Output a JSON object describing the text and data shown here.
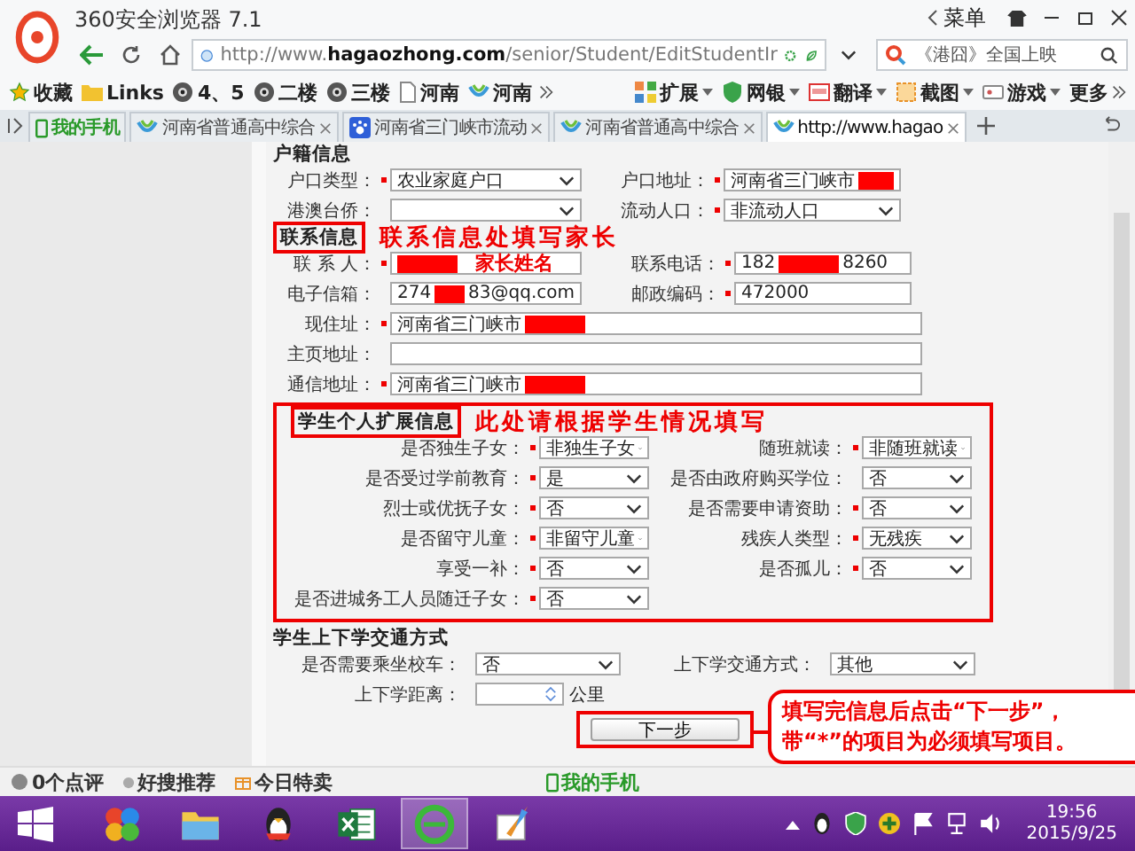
{
  "window": {
    "title": "360安全浏览器 7.1",
    "menu": "菜单"
  },
  "address_bar": {
    "url": "http://www.**hagaozhong.com**/senior/Student/EditStudentIr"
  },
  "search": {
    "value": "《港囧》全国上映"
  },
  "bookmarks": [
    {
      "label": "收藏",
      "kind": "star"
    },
    {
      "label": "Links",
      "kind": "folder"
    },
    {
      "label": "4、5",
      "kind": "camera"
    },
    {
      "label": "二楼",
      "kind": "camera"
    },
    {
      "label": "三楼",
      "kind": "camera"
    },
    {
      "label": "河南",
      "kind": "page"
    },
    {
      "label": "河南",
      "kind": "site"
    }
  ],
  "toolbar": [
    {
      "label": "扩展",
      "kind": "extensions"
    },
    {
      "label": "网银",
      "kind": "shield"
    },
    {
      "label": "翻译",
      "kind": "translate"
    },
    {
      "label": "截图",
      "kind": "screenshot"
    },
    {
      "label": "游戏",
      "kind": "game"
    },
    {
      "label": "更多",
      "kind": "more"
    }
  ],
  "tabs": [
    {
      "label": "我的手机",
      "kind": "phone",
      "selected": false
    },
    {
      "label": "河南省普通高中综合",
      "kind": "site",
      "selected": false
    },
    {
      "label": "河南省三门峡市流动",
      "kind": "paw",
      "selected": false
    },
    {
      "label": "河南省普通高中综合",
      "kind": "site",
      "selected": false
    },
    {
      "label": "http://www.hagao",
      "kind": "site",
      "selected": true
    }
  ],
  "household": {
    "title": "户籍信息",
    "fields": [
      {
        "label": "户口类型：",
        "required": true,
        "kind": "select",
        "value": "农业家庭户口"
      },
      {
        "label": "户口地址：",
        "required": true,
        "kind": "text",
        "value": "河南省三门峡市",
        "redacted": true
      },
      {
        "label": "港澳台侨：",
        "required": false,
        "kind": "select"
      },
      {
        "label": "流动人口：",
        "required": true,
        "kind": "select",
        "value": "非流动人口"
      }
    ]
  },
  "contact": {
    "title": "联系信息",
    "highlighted": true,
    "note": "联系信息处填写家长",
    "fields": [
      {
        "label": "联 系 人：",
        "required": true,
        "kind": "text",
        "redacted": true,
        "note": "家长姓名"
      },
      {
        "label": "联系电话：",
        "required": true,
        "kind": "text",
        "value": "182",
        "redacted": true,
        "value_tail": "8260"
      },
      {
        "label": "电子信箱：",
        "required": false,
        "kind": "text",
        "value": "274",
        "redacted": true,
        "value_tail": "83@qq.com"
      },
      {
        "label": "邮政编码：",
        "required": true,
        "kind": "text",
        "value": "472000"
      },
      {
        "label": "现住址：",
        "required": true,
        "kind": "wide_text",
        "value": "河南省三门峡市",
        "redacted": true
      },
      {
        "label": "主页地址：",
        "required": false,
        "kind": "wide_text"
      },
      {
        "label": "通信地址：",
        "required": true,
        "kind": "wide_text",
        "value": "河南省三门峡市",
        "redacted": true
      }
    ]
  },
  "extended": {
    "title": "学生个人扩展信息",
    "highlighted": true,
    "note": "此处请根据学生情况填写",
    "fields": [
      {
        "label": "是否独生子女：",
        "required": true,
        "kind": "select",
        "value": "非独生子女"
      },
      {
        "label": "随班就读：",
        "required": true,
        "kind": "select",
        "value": "非随班就读"
      },
      {
        "label": "是否受过学前教育：",
        "required": true,
        "kind": "select",
        "value": "是"
      },
      {
        "label": "是否由政府购买学位：",
        "required": false,
        "kind": "select",
        "value": "否"
      },
      {
        "label": "烈士或优抚子女：",
        "required": true,
        "kind": "select",
        "value": "否"
      },
      {
        "label": "是否需要申请资助：",
        "required": true,
        "kind": "select",
        "value": "否"
      },
      {
        "label": "是否留守儿童：",
        "required": true,
        "kind": "select",
        "value": "非留守儿童"
      },
      {
        "label": "残疾人类型：",
        "required": true,
        "kind": "select",
        "value": "无残疾"
      },
      {
        "label": "享受一补：",
        "required": true,
        "kind": "select",
        "value": "否"
      },
      {
        "label": "是否孤儿：",
        "required": true,
        "kind": "select",
        "value": "否"
      },
      {
        "label": "是否进城务工人员随迁子女：",
        "required": true,
        "kind": "select",
        "value": "否"
      }
    ]
  },
  "transport": {
    "title": "学生上下学交通方式",
    "fields": [
      {
        "label": "是否需要乘坐校车：",
        "required": false,
        "kind": "select",
        "value": "否"
      },
      {
        "label": "上下学交通方式：",
        "required": false,
        "kind": "select",
        "value": "其他"
      },
      {
        "label": "上下学距离：",
        "required": false,
        "kind": "number",
        "unit": "公里"
      }
    ]
  },
  "next_button": {
    "label": "下一步",
    "highlighted": true
  },
  "callout": {
    "lines": [
      "填写完信息后点击“下一步”，",
      "带“*”的项目为必须填写项目。"
    ]
  },
  "status_bar": {
    "items": [
      {
        "label": "0个点评",
        "kind": "comment"
      },
      {
        "label": "好搜推荐",
        "kind": "dot"
      },
      {
        "label": "今日特卖",
        "kind": "gift"
      }
    ],
    "phone": "我的手机"
  },
  "taskbar": {
    "apps": [
      {
        "kind": "pinwheel",
        "selected": false
      },
      {
        "kind": "folder",
        "selected": false
      },
      {
        "kind": "penguin",
        "selected": false
      },
      {
        "kind": "spreadsheet",
        "selected": false
      },
      {
        "kind": "browser",
        "selected": true
      },
      {
        "kind": "paint",
        "selected": false
      }
    ],
    "clock": {
      "time": "19:56",
      "date": "2015/9/25"
    }
  }
}
